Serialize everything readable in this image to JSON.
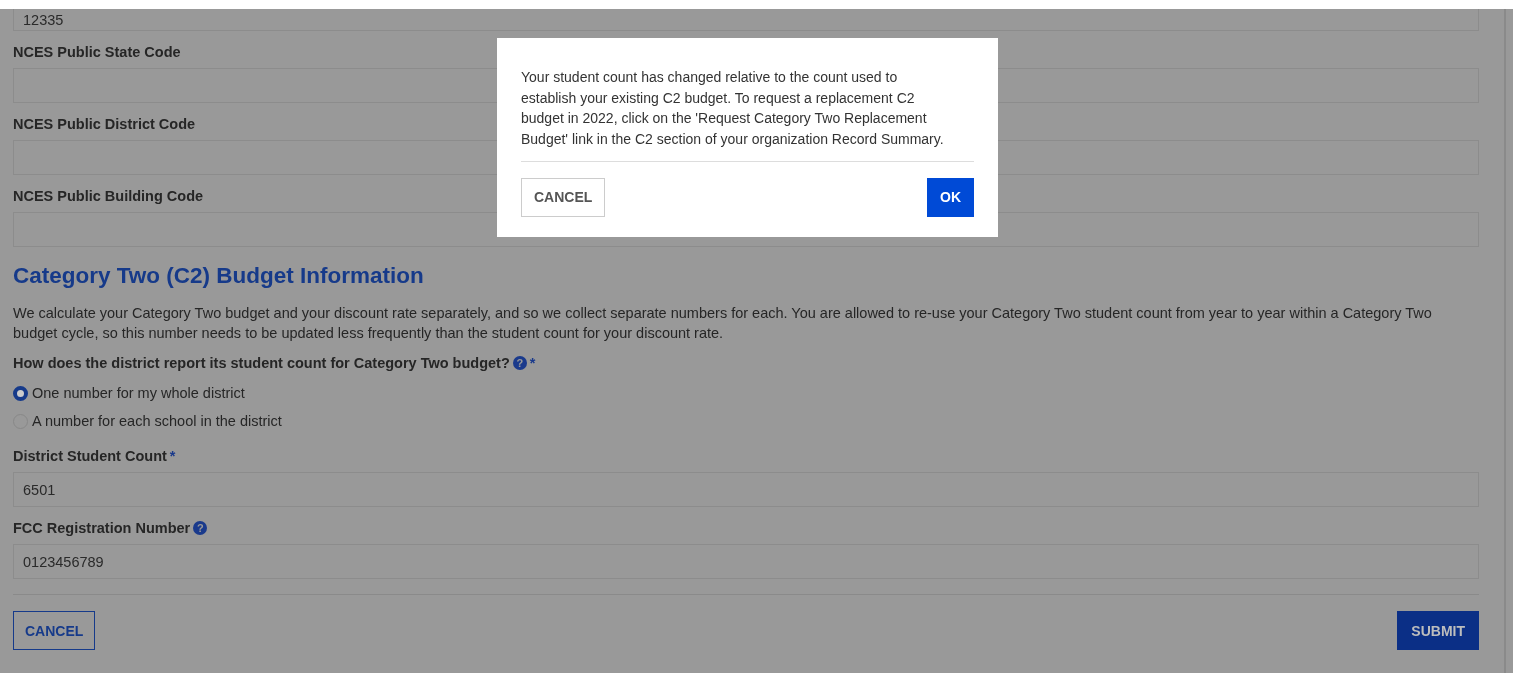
{
  "fields": [
    {
      "value": "12335"
    },
    {
      "label": "NCES Public State Code"
    },
    {
      "label": "NCES Public District Code"
    },
    {
      "label": "NCES Public Building Code"
    }
  ],
  "section": {
    "heading": "Category Two (C2) Budget Information",
    "description": "We calculate your Category Two budget and your discount rate separately, and so we collect separate numbers for each. You are allowed to re-use your Category Two student count from year to year within a Category Two budget cycle, so this number needs to be updated less frequently than the student count for your discount rate."
  },
  "question": {
    "label": "How does the district report its student count for Category Two budget?",
    "help": "?",
    "asterisk": "*"
  },
  "options": [
    {
      "label": "One number for my whole district",
      "selected": true
    },
    {
      "label": "A number for each school in the district",
      "selected": false
    }
  ],
  "count_fields": [
    {
      "label": "District Student Count",
      "asterisk": "*",
      "value": "6501"
    },
    {
      "label": "FCC Registration Number",
      "help": "?",
      "value": "0123456789"
    }
  ],
  "buttons": [
    {
      "label": "CANCEL",
      "kind": "secondary"
    },
    {
      "label": "SUBMIT",
      "kind": "primary"
    }
  ],
  "dialog": {
    "message": "Your student count has changed relative to the count used to establish your existing C2 budget. To request a replacement C2 budget in 2022, click on the 'Request Category Two Replacement Budget' link in the C2 section of your organization Record Summary.",
    "buttons": [
      {
        "label": "CANCEL",
        "kind": "secondary"
      },
      {
        "label": "OK",
        "kind": "primary"
      }
    ]
  }
}
